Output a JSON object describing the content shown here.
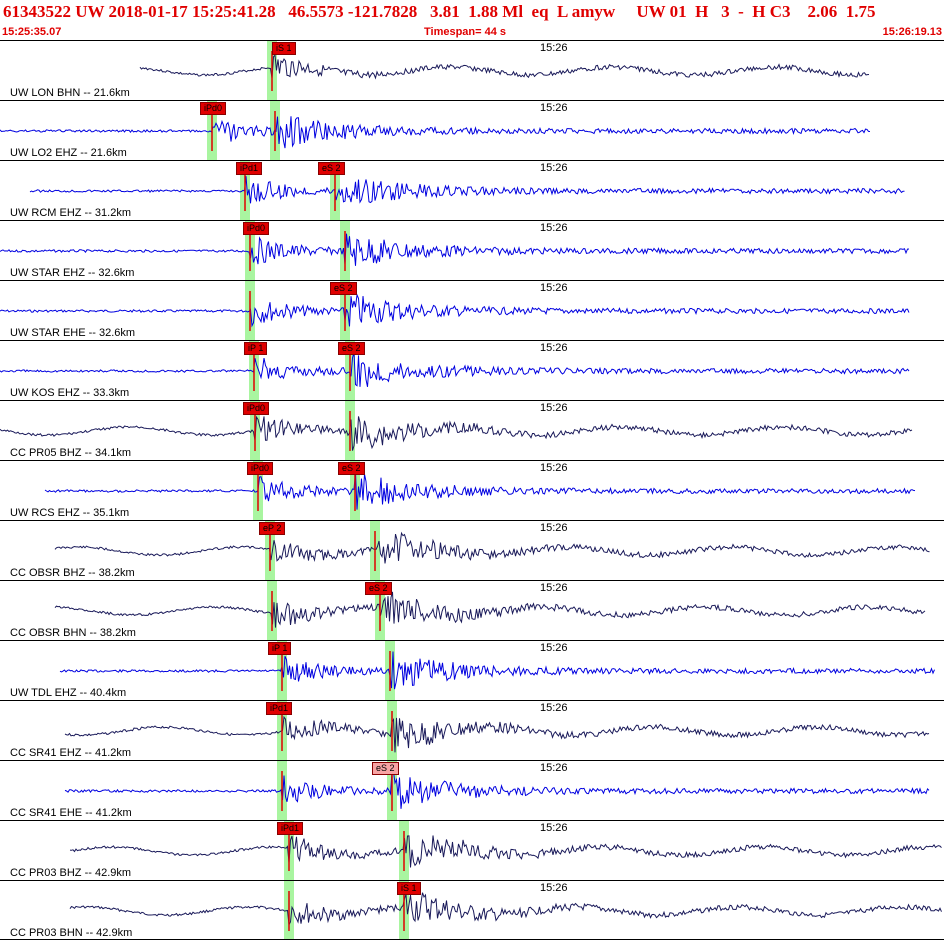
{
  "header": {
    "summary": "61343522 UW 2018-01-17 15:25:41.28   46.5573 -121.7828   3.81  1.88 Ml  eq  L amyw     UW 01  H   3  -  H C3    2.06  1.75",
    "start_time": "15:25:35.07",
    "timespan": "Timespan=  44 s",
    "end_time": "15:26:19.13"
  },
  "colors": {
    "flag": "#e00000",
    "flag_light": "#f7a4a4",
    "window": "#a9f5a0",
    "trace_blue": "#0000e0",
    "trace_navy": "#1a1a5a",
    "marker": "#e00000"
  },
  "panels": [
    {
      "label": "UW LON BHN -- 21.6km",
      "time": "15:26",
      "color": "navy",
      "picks": [
        {
          "text": "iS 1",
          "phase": "S"
        }
      ]
    },
    {
      "label": "UW LO2 EHZ -- 21.6km",
      "time": "15:26",
      "color": "blue",
      "picks": [
        {
          "text": "iPd0",
          "phase": "P"
        }
      ]
    },
    {
      "label": "UW RCM EHZ -- 31.2km",
      "time": "15:26",
      "color": "blue",
      "picks": [
        {
          "text": "iPd1",
          "phase": "P"
        },
        {
          "text": "eS 2",
          "phase": "S"
        }
      ]
    },
    {
      "label": "UW STAR EHZ -- 32.6km",
      "time": "15:26",
      "color": "blue",
      "picks": [
        {
          "text": "iPd0",
          "phase": "P"
        }
      ]
    },
    {
      "label": "UW STAR EHE -- 32.6km",
      "time": "15:26",
      "color": "blue",
      "picks": [
        {
          "text": "eS 2",
          "phase": "S"
        }
      ]
    },
    {
      "label": "UW KOS EHZ -- 33.3km",
      "time": "15:26",
      "color": "blue",
      "picks": [
        {
          "text": "iP 1",
          "phase": "P"
        },
        {
          "text": "eS 2",
          "phase": "S"
        }
      ]
    },
    {
      "label": "CC PR05 BHZ -- 34.1km",
      "time": "15:26",
      "color": "navy",
      "picks": [
        {
          "text": "iPd0",
          "phase": "P"
        }
      ]
    },
    {
      "label": "UW RCS EHZ -- 35.1km",
      "time": "15:26",
      "color": "blue",
      "picks": [
        {
          "text": "iPd0",
          "phase": "P"
        },
        {
          "text": "eS 2",
          "phase": "S"
        }
      ]
    },
    {
      "label": "CC OBSR BHZ -- 38.2km",
      "time": "15:26",
      "color": "navy",
      "picks": [
        {
          "text": "eP 2",
          "phase": "P"
        }
      ]
    },
    {
      "label": "CC OBSR BHN -- 38.2km",
      "time": "15:26",
      "color": "navy",
      "picks": [
        {
          "text": "eS 2",
          "phase": "S"
        }
      ]
    },
    {
      "label": "UW TDL EHZ -- 40.4km",
      "time": "15:26",
      "color": "blue",
      "picks": [
        {
          "text": "iP 1",
          "phase": "P"
        }
      ]
    },
    {
      "label": "CC SR41 EHZ -- 41.2km",
      "time": "15:26",
      "color": "navy",
      "picks": [
        {
          "text": "iPd1",
          "phase": "P"
        }
      ]
    },
    {
      "label": "CC SR41 EHE -- 41.2km",
      "time": "15:26",
      "color": "blue",
      "picks": [
        {
          "text": "eS 2",
          "phase": "S",
          "light": true
        }
      ]
    },
    {
      "label": "CC PR03 BHZ -- 42.9km",
      "time": "15:26",
      "color": "navy",
      "picks": [
        {
          "text": "iPd1",
          "phase": "P"
        }
      ]
    },
    {
      "label": "CC PR03 BHN -- 42.9km",
      "time": "15:26",
      "color": "navy",
      "picks": [
        {
          "text": "iS 1",
          "phase": "S"
        }
      ]
    }
  ]
}
